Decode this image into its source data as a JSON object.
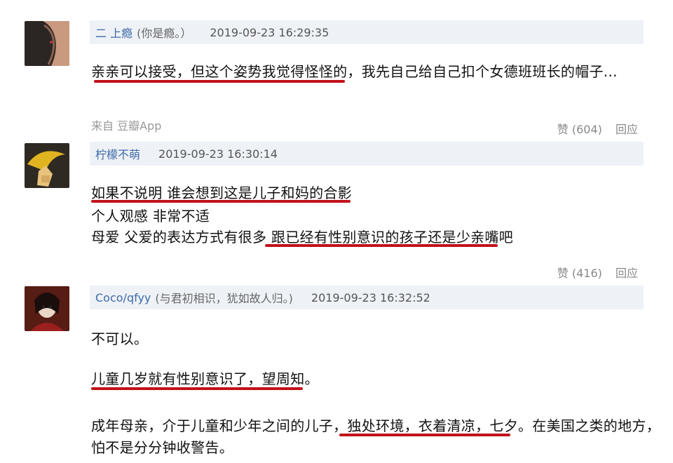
{
  "comments": [
    {
      "username": "二 上瘾",
      "motto": "(你是瘾。）",
      "time": "2019-09-23 16:29:35",
      "lines": [
        "亲亲可以接受，但这个姿势我觉得怪怪的，我先自己给自己扣个女德班班长的帽子..."
      ],
      "source": "来自 豆瓣App",
      "like": "赞 (604)",
      "reply": "回应"
    },
    {
      "username": "柠檬不萌",
      "motto": "",
      "time": "2019-09-23 16:30:14",
      "lines": [
        "如果不说明 谁会想到这是儿子和妈的合影",
        "个人观感 非常不适",
        "母爱 父爱的表达方式有很多 跟已经有性别意识的孩子还是少亲嘴吧"
      ],
      "like": "赞 (416)",
      "reply": "回应"
    },
    {
      "username": "Coco/qfyy",
      "motto": "(与君初相识，犹如故人归。)",
      "time": "2019-09-23 16:32:52",
      "lines": [
        "不可以。",
        "儿童几岁就有性别意识了，望周知。",
        "成年母亲，介于儿童和少年之间的儿子，独处环境，衣着清凉，七夕。在美国之类的地方，",
        "怕不是分分钟收警告。"
      ]
    }
  ]
}
